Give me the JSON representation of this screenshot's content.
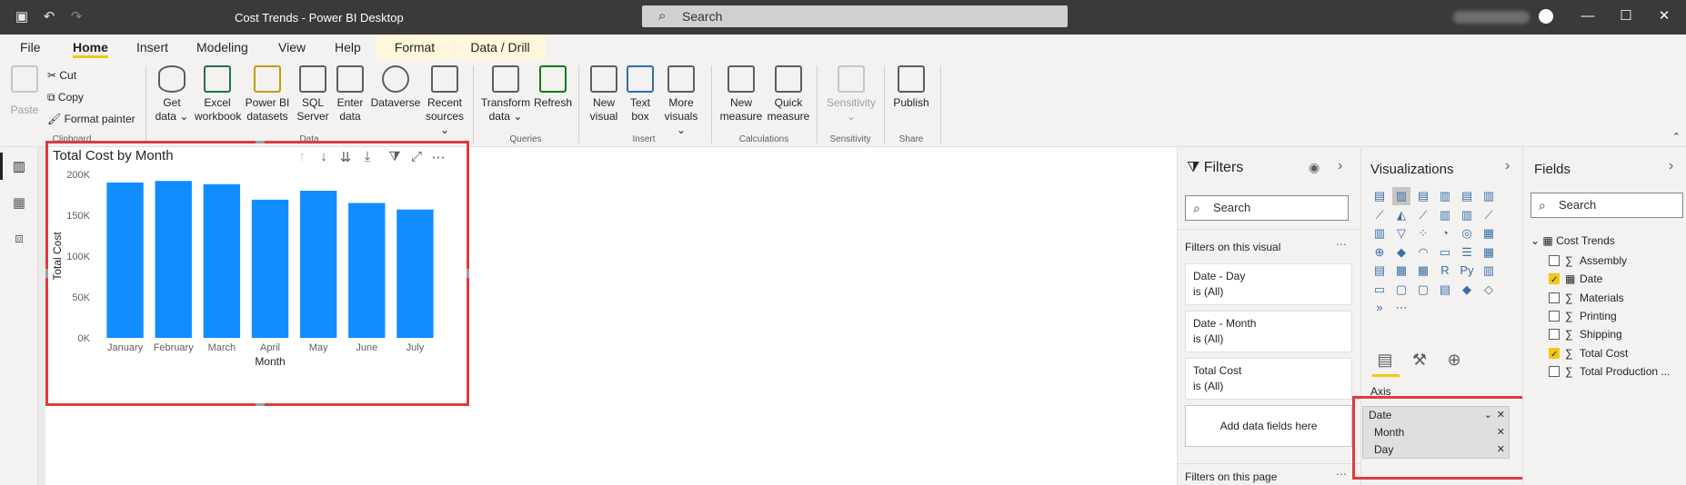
{
  "window": {
    "title": "Cost Trends - Power BI Desktop",
    "search_placeholder": "Search"
  },
  "menu": {
    "tabs": [
      "File",
      "Home",
      "Insert",
      "Modeling",
      "View",
      "Help",
      "Format",
      "Data / Drill"
    ],
    "active": "Home"
  },
  "ribbon": {
    "clipboard": {
      "paste": "Paste",
      "cut": "Cut",
      "copy": "Copy",
      "format_painter": "Format painter",
      "group": "Clipboard"
    },
    "data": {
      "get_data": [
        "Get",
        "data"
      ],
      "excel": [
        "Excel",
        "workbook"
      ],
      "pbi": [
        "Power BI",
        "datasets"
      ],
      "sql": [
        "SQL",
        "Server"
      ],
      "enter": [
        "Enter",
        "data"
      ],
      "dataverse": [
        "Dataverse",
        ""
      ],
      "recent": [
        "Recent",
        "sources"
      ],
      "group": "Data"
    },
    "queries": {
      "transform": [
        "Transform",
        "data"
      ],
      "refresh": [
        "Refresh",
        ""
      ],
      "group": "Queries"
    },
    "insert": {
      "new_visual": [
        "New",
        "visual"
      ],
      "text_box": [
        "Text",
        "box"
      ],
      "more_visuals": [
        "More",
        "visuals"
      ],
      "group": "Insert"
    },
    "calculations": {
      "new_measure": [
        "New",
        "measure"
      ],
      "quick_measure": [
        "Quick",
        "measure"
      ],
      "group": "Calculations"
    },
    "sensitivity": {
      "label": "Sensitivity",
      "group": "Sensitivity"
    },
    "share": {
      "publish": "Publish",
      "group": "Share"
    }
  },
  "visual": {
    "title": "Total Cost by Month"
  },
  "chart_data": {
    "type": "bar",
    "title": "Total Cost by Month",
    "categories": [
      "January",
      "February",
      "March",
      "April",
      "May",
      "June",
      "July"
    ],
    "values": [
      190000,
      192000,
      188000,
      169000,
      180000,
      165000,
      157000
    ],
    "xlabel": "Month",
    "ylabel": "Total Cost",
    "ylim": [
      0,
      200000
    ],
    "yticks": [
      "0K",
      "50K",
      "100K",
      "150K",
      "200K"
    ],
    "color": "#118dff",
    "grid": false
  },
  "filters": {
    "title": "Filters",
    "search": "Search",
    "on_visual": "Filters on this visual",
    "cards": [
      {
        "name": "Date - Day",
        "state": "is (All)"
      },
      {
        "name": "Date - Month",
        "state": "is (All)"
      },
      {
        "name": "Total Cost",
        "state": "is (All)"
      }
    ],
    "add": "Add data fields here",
    "on_page": "Filters on this page"
  },
  "visualizations": {
    "title": "Visualizations",
    "axis_label": "Axis",
    "axis_items": [
      "Date",
      "Month",
      "Day"
    ]
  },
  "fields": {
    "title": "Fields",
    "search": "Search",
    "table": "Cost Trends",
    "items": [
      {
        "label": "Assembly",
        "checked": false
      },
      {
        "label": "Date",
        "checked": true
      },
      {
        "label": "Materials",
        "checked": false
      },
      {
        "label": "Printing",
        "checked": false
      },
      {
        "label": "Shipping",
        "checked": false
      },
      {
        "label": "Total Cost",
        "checked": true
      },
      {
        "label": "Total Production ...",
        "checked": false
      }
    ]
  },
  "colors": {
    "accent": "#f2c811",
    "bar": "#118dff",
    "highlight": "#e03a3e"
  }
}
